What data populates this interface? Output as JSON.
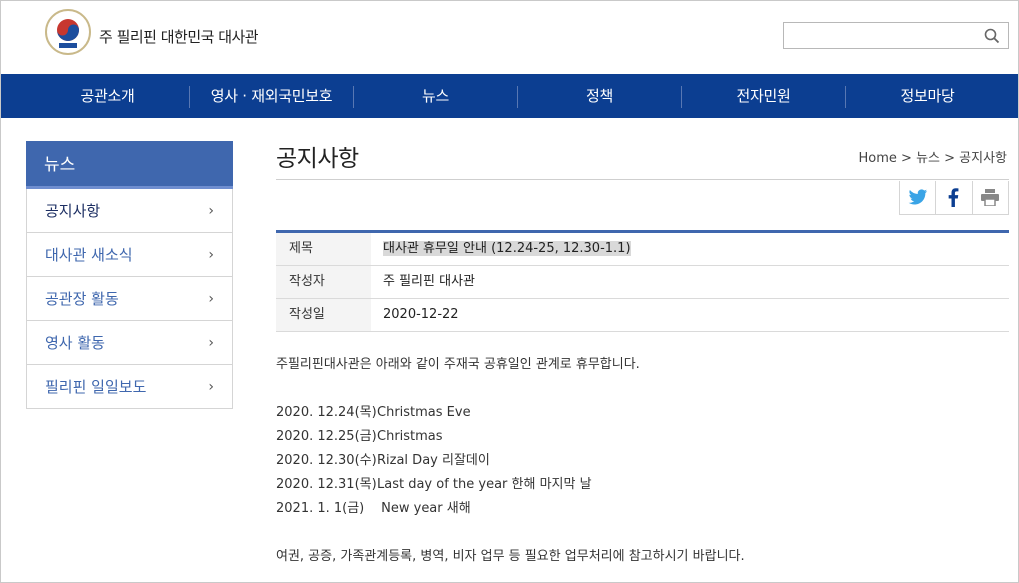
{
  "header": {
    "site_title": "주 필리핀 대한민국 대사관",
    "search_placeholder": "",
    "search_icon": "search-icon",
    "logo_icon": "emblem-logo"
  },
  "nav": {
    "items": [
      "공관소개",
      "영사 · 재외국민보호",
      "뉴스",
      "정책",
      "전자민원",
      "정보마당"
    ]
  },
  "sidebar": {
    "heading": "뉴스",
    "items": [
      {
        "label": "공지사항"
      },
      {
        "label": "대사관 새소식"
      },
      {
        "label": "공관장 활동"
      },
      {
        "label": "영사 활동"
      },
      {
        "label": "필리핀 일일보도"
      }
    ],
    "chevron": "›"
  },
  "main": {
    "title": "공지사항",
    "breadcrumb": "Home > 뉴스 > 공지사항"
  },
  "share": {
    "icons": [
      "twitter-icon",
      "facebook-icon",
      "print-icon"
    ],
    "twitter_color": "#3aa4e6",
    "facebook_color": "#0c3e91",
    "print_color": "#888888"
  },
  "post": {
    "subject_label": "제목",
    "subject_value": "대사관 휴무일 안내 (12.24-25, 12.30-1.1)",
    "author_label": "작성자",
    "author_value": "주 필리핀 대사관",
    "date_label": "작성일",
    "date_value": "2020-12-22"
  },
  "body": {
    "intro": "주필리핀대사관은 아래와 같이 주재국 공휴일인 관계로 휴무합니다.",
    "schedule": [
      {
        "date": "2020. 12.24(목)",
        "desc": "Christmas Eve"
      },
      {
        "date": "2020. 12.25(금)",
        "desc": "Christmas"
      },
      {
        "date": "2020. 12.30(수)",
        "desc": "Rizal Day 리잘데이"
      },
      {
        "date": "2020. 12.31(목)",
        "desc": "Last day of the year  한해 마지막 날"
      },
      {
        "date": "2021. 1. 1(금)",
        "desc": " New year 새해"
      }
    ],
    "note": "여권, 공증, 가족관계등록, 병역, 비자 업무 등 필요한 업무처리에 참고하시기 바랍니다."
  },
  "colors": {
    "nav_bg": "#0c3e91",
    "sidebar_head_bg": "#3f67ae",
    "accent": "#3f67ae"
  }
}
